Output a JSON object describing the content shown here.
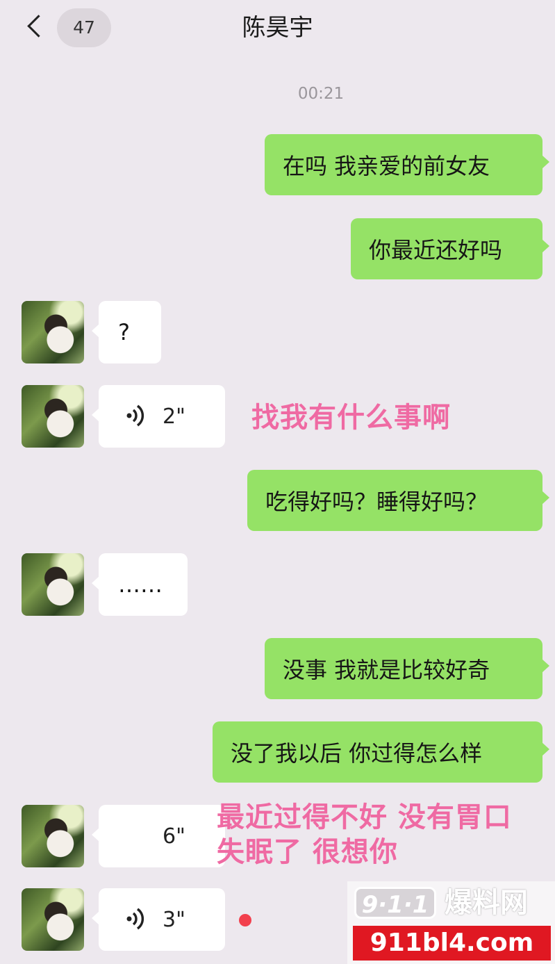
{
  "header": {
    "back_label": "<",
    "unread_count": "47",
    "title": "陈昊宇"
  },
  "timestamp": "00:21",
  "messages": [
    {
      "sender": "me",
      "text": "在吗 我亲爱的前女友"
    },
    {
      "sender": "me",
      "text": "你最近还好吗"
    },
    {
      "sender": "them",
      "text": "?"
    },
    {
      "sender": "them",
      "type": "voice",
      "duration": "2\""
    },
    {
      "sender": "me",
      "text": "吃得好吗？睡得好吗？"
    },
    {
      "sender": "them",
      "text": "……"
    },
    {
      "sender": "me",
      "text": "没事 我就是比较好奇"
    },
    {
      "sender": "me",
      "text": "没了我以后 你过得怎么样"
    },
    {
      "sender": "them",
      "type": "voice",
      "duration": "6\""
    },
    {
      "sender": "them",
      "type": "voice",
      "duration": "3\"",
      "unread": true
    }
  ],
  "captions": [
    "找我有什么事啊",
    "最近过得不好 没有胃口",
    "失眠了 很想你"
  ],
  "watermark": {
    "badge": "9·1·1",
    "brand": "爆料网",
    "url": "911bl4.com"
  },
  "icons": {
    "back": "chevron-left-icon",
    "voice": "voice-wave-icon",
    "unread": "red-dot-icon"
  },
  "colors": {
    "my_bubble": "#95e266",
    "their_bubble": "#ffffff",
    "background": "#ede8ee",
    "caption": "#ef6aa3",
    "unread_dot": "#f2404d"
  }
}
